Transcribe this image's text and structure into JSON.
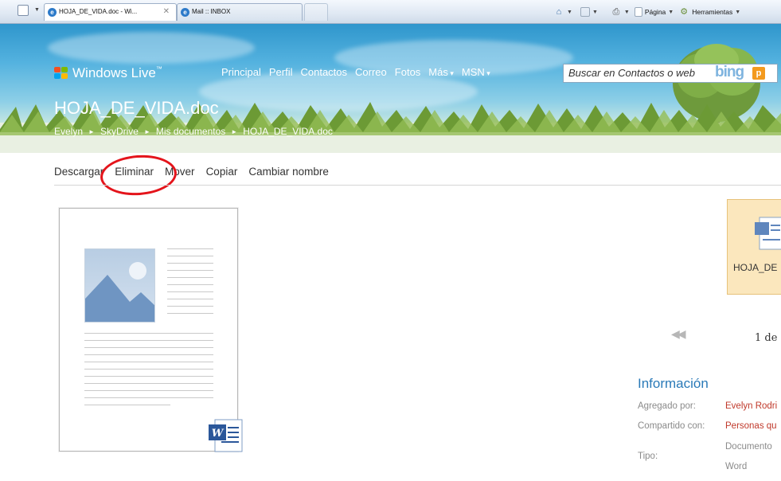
{
  "browser": {
    "tabs": [
      {
        "label": "HOJA_DE_VIDA.doc - Wi...",
        "active": true
      },
      {
        "label": "Mail :: INBOX",
        "active": false
      }
    ],
    "commands": {
      "page": "Página",
      "tools": "Herramientas"
    }
  },
  "header": {
    "logo_text": "Windows Live",
    "logo_tm": "™",
    "nav": [
      {
        "label": "Principal",
        "dropdown": false
      },
      {
        "label": "Perfil",
        "dropdown": false
      },
      {
        "label": "Contactos",
        "dropdown": false
      },
      {
        "label": "Correo",
        "dropdown": false
      },
      {
        "label": "Fotos",
        "dropdown": false
      },
      {
        "label": "Más",
        "dropdown": true
      },
      {
        "label": "MSN",
        "dropdown": true
      }
    ],
    "search_placeholder": "Buscar en Contactos o web",
    "search_brand": "bing",
    "page_title": "HOJA_DE_VIDA.doc",
    "breadcrumb": [
      "Evelyn",
      "SkyDrive",
      "Mis documentos",
      "HOJA_DE_VIDA.doc"
    ]
  },
  "actions": [
    "Descargar",
    "Eliminar",
    "Mover",
    "Copiar",
    "Cambiar nombre"
  ],
  "highlighted_action": "Eliminar",
  "thumbnail": {
    "label": "HOJA_DE"
  },
  "pager": {
    "text": "1 de"
  },
  "info": {
    "title": "Información",
    "rows": [
      {
        "label": "Agregado por:",
        "value": "Evelyn Rodri"
      },
      {
        "label": "Compartido con:",
        "value": "Personas qu"
      },
      {
        "label": "Tipo:",
        "value": "Documento",
        "value2": "Word"
      }
    ]
  },
  "colors": {
    "accent_blue": "#2a7ab8",
    "highlight_red": "#e4141b",
    "thumb_bg": "#fbe7bd",
    "info_value": "#c0392b"
  }
}
